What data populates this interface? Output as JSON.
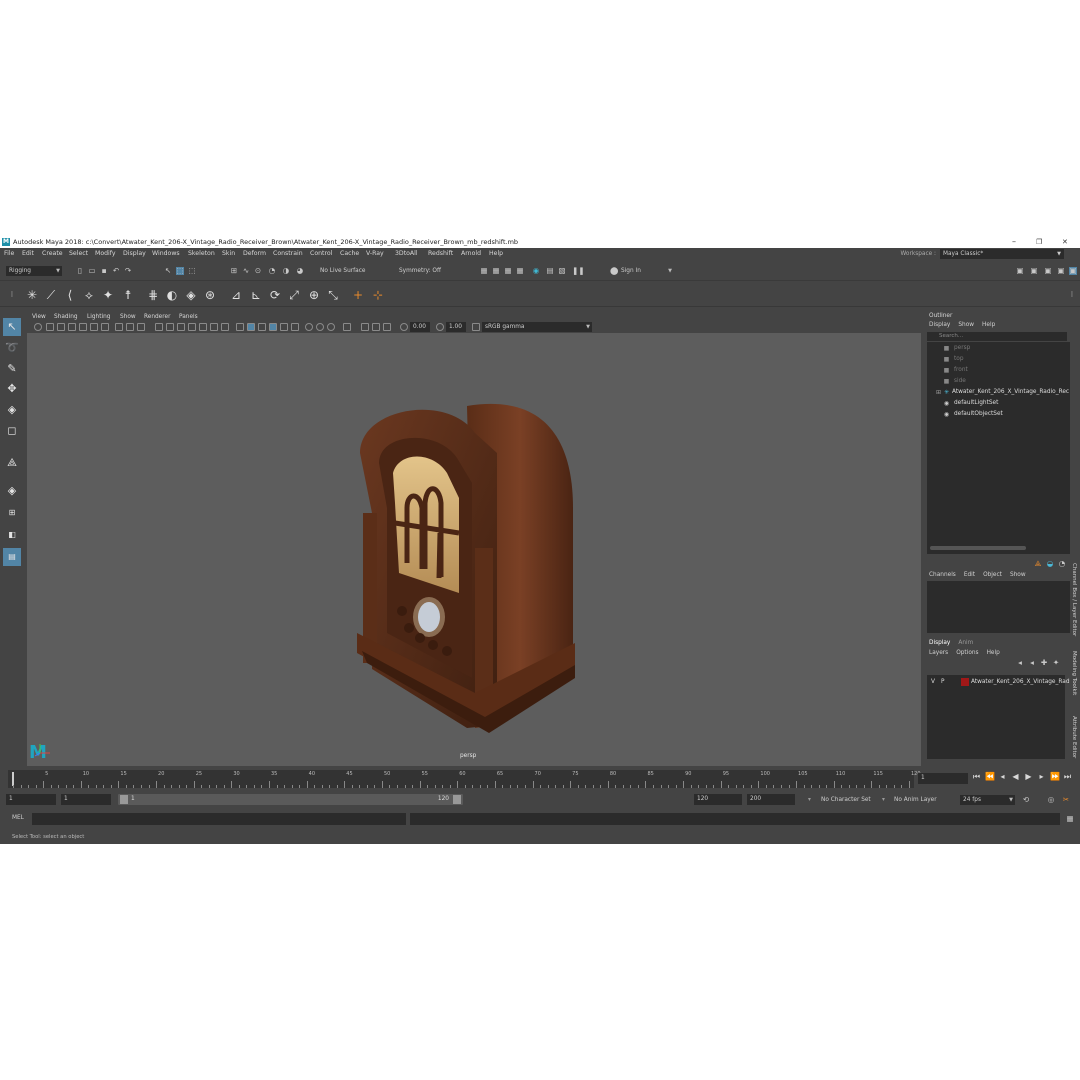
{
  "window": {
    "title": "Autodesk Maya 2018: c:\\Convert\\Atwater_Kent_206-X_Vintage_Radio_Receiver_Brown\\Atwater_Kent_206-X_Vintage_Radio_Receiver_Brown_mb_redshift.mb",
    "logo": "M",
    "minimize": "–",
    "maximize": "❐",
    "close": "✕"
  },
  "menubar": {
    "items": [
      "File",
      "Edit",
      "Create",
      "Select",
      "Modify",
      "Display",
      "Windows",
      "Skeleton",
      "Skin",
      "Deform",
      "Constrain",
      "Control",
      "Cache",
      "V-Ray",
      "3DtoAll",
      "Redshift",
      "Arnold",
      "Help"
    ],
    "workspace_label": "Workspace :",
    "workspace_value": "Maya Classic*"
  },
  "statusline": {
    "menuset": "Rigging",
    "live_surface": "No Live Surface",
    "symmetry": "Symmetry: Off",
    "sign_in": "Sign In"
  },
  "viewport": {
    "menu": [
      "View",
      "Shading",
      "Lighting",
      "Show",
      "Renderer",
      "Panels"
    ],
    "exposure": "0.00",
    "gamma": "1.00",
    "color_space": "sRGB gamma",
    "camera_label": "persp",
    "logo": "M"
  },
  "outliner": {
    "title": "Outliner",
    "menu": [
      "Display",
      "Show",
      "Help"
    ],
    "search_placeholder": "Search...",
    "items": [
      {
        "label": "persp",
        "dim": true
      },
      {
        "label": "top",
        "dim": true
      },
      {
        "label": "front",
        "dim": true
      },
      {
        "label": "side",
        "dim": true
      },
      {
        "label": "Atwater_Kent_206_X_Vintage_Radio_Rec",
        "dim": false
      },
      {
        "label": "defaultLightSet",
        "dim": false
      },
      {
        "label": "defaultObjectSet",
        "dim": false
      }
    ]
  },
  "channelbox": {
    "menu": [
      "Channels",
      "Edit",
      "Object",
      "Show"
    ]
  },
  "layers": {
    "tabs": [
      "Display",
      "Anim"
    ],
    "menu": [
      "Layers",
      "Options",
      "Help"
    ],
    "layer_v": "V",
    "layer_p": "P",
    "layer_name": "Atwater_Kent_206_X_Vintage_Rad",
    "layer_color": "#a01818"
  },
  "sidetabs": [
    "Channel Box / Layer Editor",
    "Modeling Toolkit",
    "Attribute Editor"
  ],
  "timeline": {
    "ticks": [
      "5",
      "10",
      "15",
      "20",
      "25",
      "30",
      "35",
      "40",
      "45",
      "50",
      "55",
      "60",
      "65",
      "70",
      "75",
      "80",
      "85",
      "90",
      "95",
      "100",
      "105",
      "110",
      "115",
      "120"
    ],
    "current_frame": "1"
  },
  "range": {
    "start": "1",
    "playback_start": "1",
    "slider_start": "1",
    "slider_end": "120",
    "playback_end": "120",
    "end": "200",
    "character_set": "No Character Set",
    "anim_layer": "No Anim Layer",
    "fps": "24 fps"
  },
  "command": {
    "lang": "MEL"
  },
  "help": {
    "text": "Select Tool: select an object"
  },
  "colors": {
    "accent": "#5285a6",
    "maya_logo": "#1fa5c0",
    "panel_bg": "#444444",
    "field_bg": "#2b2b2b",
    "viewport_bg": "#5d5d5d"
  }
}
